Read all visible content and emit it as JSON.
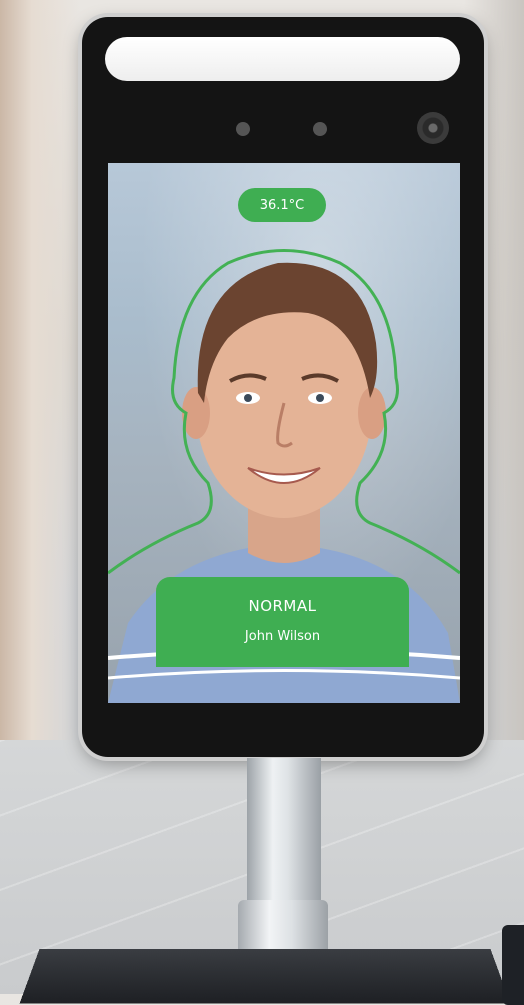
{
  "screen": {
    "temperature": "36.1°C",
    "status": "NORMAL",
    "name": "John Wilson"
  },
  "colors": {
    "accent": "#3fae52",
    "device_frame": "#141414",
    "outline": "#43b154"
  },
  "icons": [
    "camera-icon",
    "sensor-dot"
  ]
}
